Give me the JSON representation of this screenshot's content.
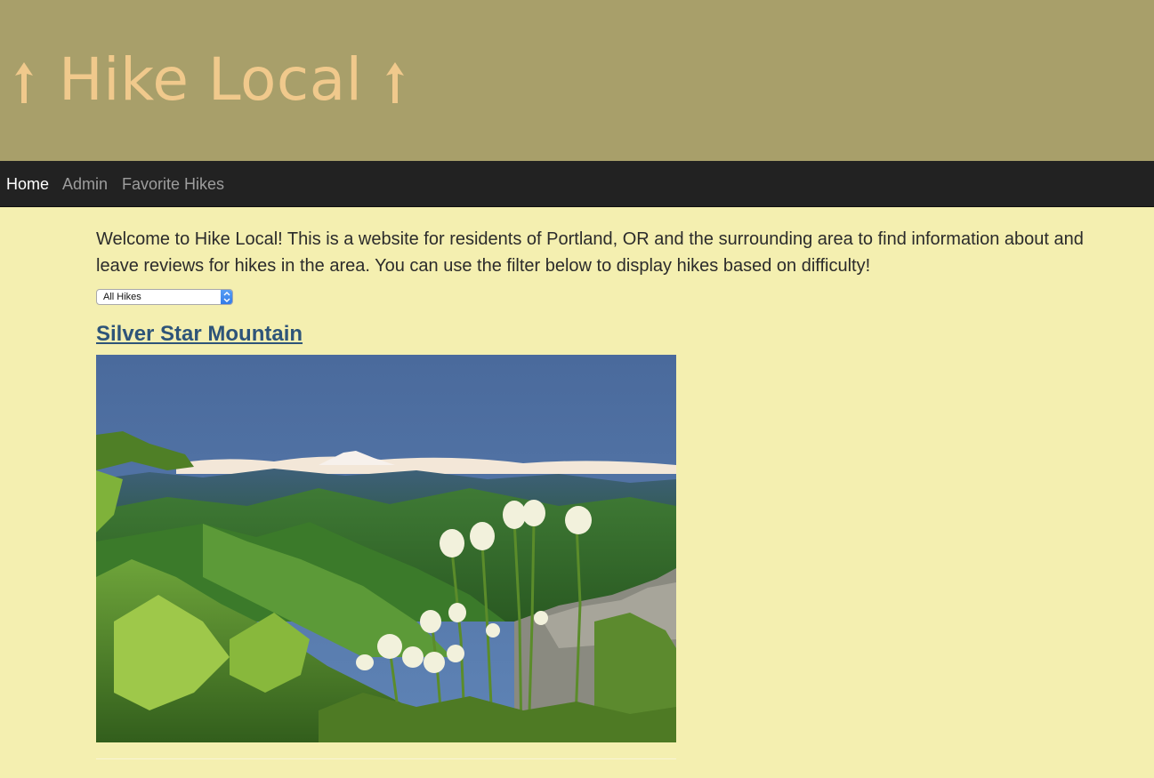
{
  "header": {
    "title": "Hike Local",
    "left_icon": "tree-arrow-icon",
    "right_icon": "tree-arrow-icon",
    "title_color": "#f0c98c",
    "background": "#a89f6a"
  },
  "nav": {
    "items": [
      {
        "label": "Home",
        "active": true
      },
      {
        "label": "Admin",
        "active": false
      },
      {
        "label": "Favorite Hikes",
        "active": false
      }
    ]
  },
  "main": {
    "intro": "Welcome to Hike Local! This is a website for residents of Portland, OR and the surrounding area to find information about and leave reviews for hikes in the area. You can use the filter below to display hikes based on difficulty!",
    "filter": {
      "selected": "All Hikes"
    },
    "hikes": [
      {
        "name": "Silver Star Mountain",
        "image": "mountain-landscape-photo"
      }
    ]
  },
  "colors": {
    "page_background": "#f4efb0",
    "navbar": "#222222",
    "link": "#2e5479"
  }
}
